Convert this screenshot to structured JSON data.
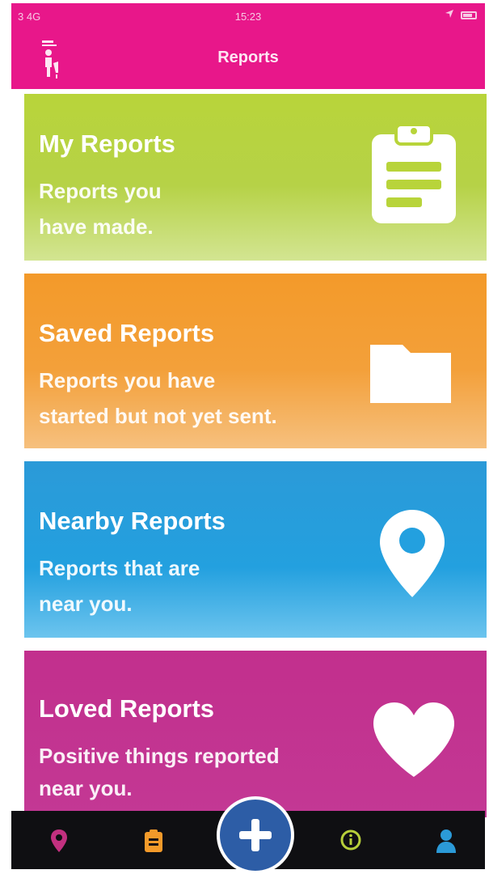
{
  "status_bar": {
    "signal_carrier": "3 4G",
    "time": "15:23"
  },
  "header": {
    "title": "Reports"
  },
  "cards": [
    {
      "title": "My Reports",
      "desc_line1": "Reports you",
      "desc_line2": "have made.",
      "icon": "clipboard-icon"
    },
    {
      "title": "Saved Reports",
      "desc_line1": "Reports you have",
      "desc_line2": "started but not yet sent.",
      "icon": "folder-icon"
    },
    {
      "title": "Nearby Reports",
      "desc_line1": "Reports that are",
      "desc_line2": "near you.",
      "icon": "location-pin-icon"
    },
    {
      "title": "Loved Reports",
      "desc_line1": "Positive things reported",
      "desc_line2": "near you.",
      "icon": "heart-icon"
    }
  ],
  "tab_bar": {
    "tabs": [
      {
        "icon": "map-pin-tab-icon",
        "color": "#c2307f"
      },
      {
        "icon": "clipboard-tab-icon",
        "color": "#f39a2a"
      },
      {
        "icon": "plus-icon",
        "color": "#2d5da6"
      },
      {
        "icon": "info-icon",
        "color": "#b7cf3a"
      },
      {
        "icon": "profile-icon",
        "color": "#2b9ad8"
      }
    ]
  },
  "colors": {
    "header": "#e8178a",
    "my_reports": "#b8d43a",
    "saved_reports": "#f39a2a",
    "nearby_reports": "#23a0df",
    "loved_reports": "#c33894"
  }
}
